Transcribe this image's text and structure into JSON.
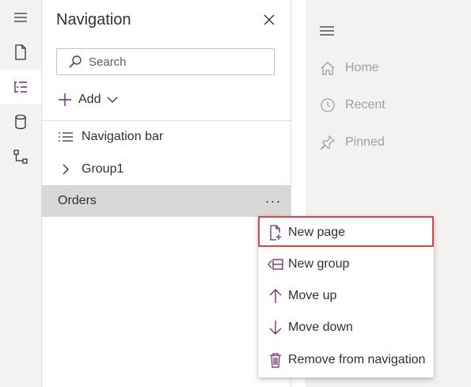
{
  "rail": {
    "items": [
      {
        "icon": "hamburger-icon"
      },
      {
        "icon": "page-icon"
      },
      {
        "icon": "tree-view-icon",
        "active": true
      },
      {
        "icon": "database-icon"
      },
      {
        "icon": "connector-icon"
      }
    ]
  },
  "panel": {
    "title": "Navigation",
    "search": {
      "placeholder": "Search"
    },
    "add_label": "Add",
    "tree": [
      {
        "label": "Navigation bar",
        "icon": "list-icon"
      },
      {
        "label": "Group1",
        "icon": "chevron-right-icon"
      },
      {
        "label": "Orders",
        "selected": true,
        "more": "···"
      }
    ]
  },
  "preview": {
    "items": [
      {
        "label": "Home",
        "icon": "home-icon"
      },
      {
        "label": "Recent",
        "icon": "clock-icon"
      },
      {
        "label": "Pinned",
        "icon": "pin-icon"
      }
    ]
  },
  "context_menu": {
    "items": [
      {
        "label": "New page",
        "icon": "new-page-icon",
        "highlighted": true
      },
      {
        "label": "New group",
        "icon": "new-group-icon"
      },
      {
        "label": "Move up",
        "icon": "arrow-up-icon"
      },
      {
        "label": "Move down",
        "icon": "arrow-down-icon"
      },
      {
        "label": "Remove from navigation",
        "icon": "trash-icon"
      }
    ]
  },
  "colors": {
    "accent": "#742774",
    "highlight_border": "#e0434b",
    "selected_row": "#d9d8d7",
    "rail_bg": "#f3f2f1"
  }
}
